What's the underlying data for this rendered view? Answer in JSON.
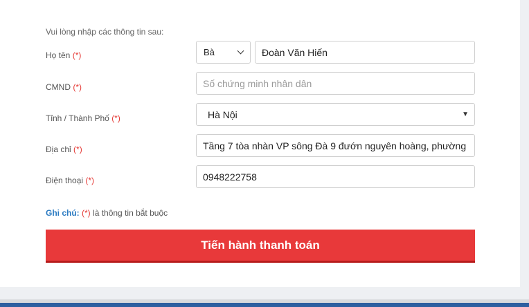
{
  "form": {
    "intro": "Vui lòng nhập các thông tin sau:",
    "required_mark": "(*)",
    "name": {
      "label": "Họ tên",
      "title_value": "Bà",
      "value": "Đoàn Văn Hiến"
    },
    "id_card": {
      "label": "CMND",
      "placeholder": "Số chứng minh nhân dân"
    },
    "city": {
      "label": "Tỉnh / Thành Phố",
      "value": "Hà Nội"
    },
    "address": {
      "label": "Địa chỉ",
      "value": "Tầng 7 tòa nhàn VP sông Đà 9 đướn nguyên hoàng, phường"
    },
    "phone": {
      "label": "Điện thoại",
      "value": "0948222758"
    },
    "note": {
      "label": "Ghi chú:",
      "text": "là thông tin bắt buộc"
    },
    "submit_label": "Tiến hành thanh toán"
  },
  "colors": {
    "accent": "#e8393a",
    "required": "#e53935",
    "note_label": "#2b7bc2",
    "bottom_bar": "#2d5fa0"
  }
}
